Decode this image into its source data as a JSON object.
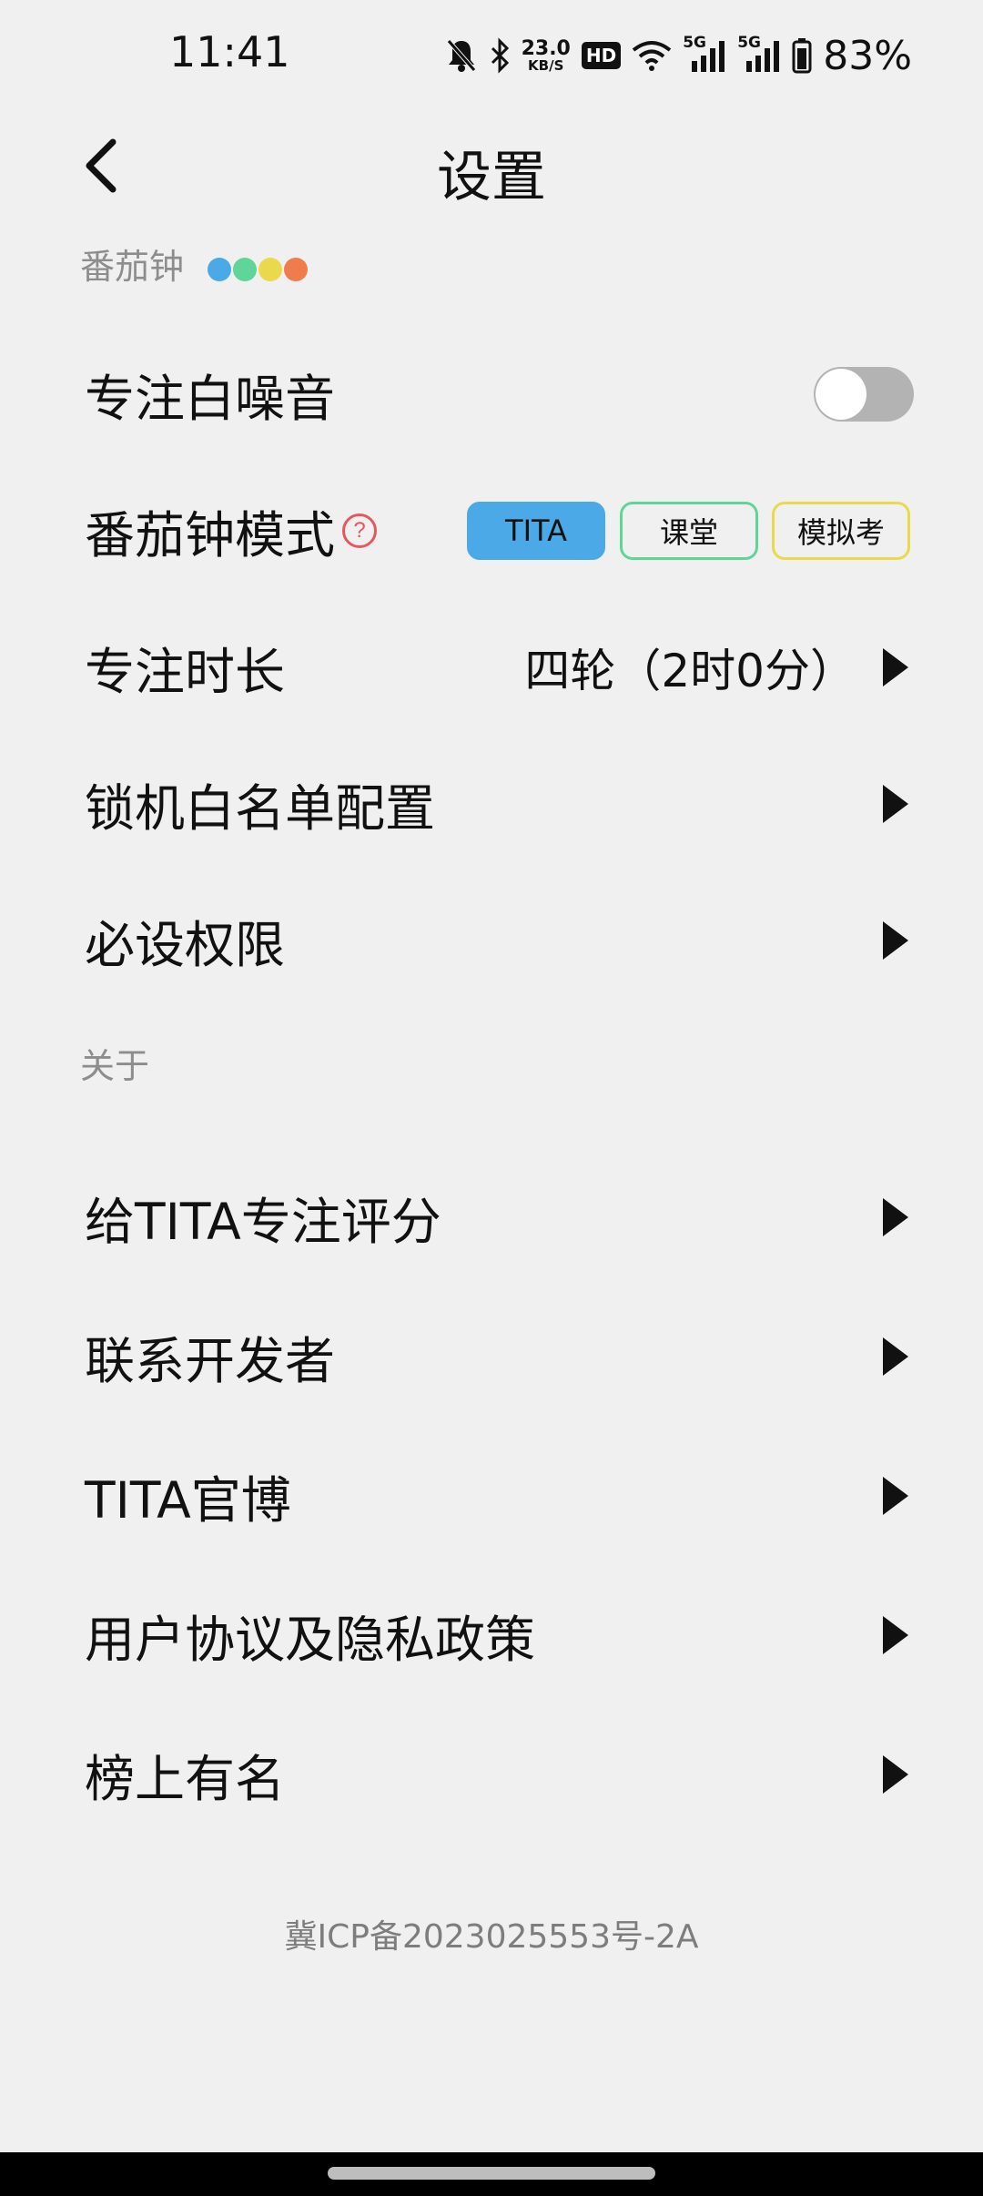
{
  "status_bar": {
    "time": "11:41",
    "net_speed_value": "23.0",
    "net_speed_unit": "KB/S",
    "hd_label": "HD",
    "network_type_1": "5G",
    "network_type_2": "5G",
    "battery_percent": "83%",
    "icons": [
      "mute-icon",
      "bluetooth-icon",
      "wifi-icon",
      "signal-icon",
      "signal-icon",
      "battery-icon"
    ]
  },
  "header": {
    "title": "设置",
    "back_icon": "chevron-left-icon"
  },
  "sections": {
    "pomodoro": {
      "title": "番茄钟",
      "dot_colors": [
        "#4aa9e6",
        "#5fd59a",
        "#ead94b",
        "#f07c4d"
      ]
    },
    "about": {
      "title": "关于"
    }
  },
  "rows": {
    "white_noise": {
      "label": "专注白噪音",
      "toggle_on": false
    },
    "mode": {
      "label": "番茄钟模式",
      "help": "?",
      "options": [
        "TITA",
        "课堂",
        "模拟考"
      ],
      "selected": "TITA"
    },
    "duration": {
      "label": "专注时长",
      "value": "四轮（2时0分）"
    },
    "whitelist": {
      "label": "锁机白名单配置"
    },
    "permissions": {
      "label": "必设权限"
    },
    "rate": {
      "label": "给TITA专注评分"
    },
    "contact": {
      "label": "联系开发者"
    },
    "weibo": {
      "label": "TITA官博"
    },
    "policy": {
      "label": "用户协议及隐私政策"
    },
    "leaderboard": {
      "label": "榜上有名"
    }
  },
  "footer": {
    "icp": "冀ICP备2023025553号-2A"
  },
  "colors": {
    "background": "#f0f0f0",
    "accent_blue": "#4aa9e6",
    "accent_green": "#5fd59a",
    "accent_yellow": "#ead94b",
    "accent_orange": "#f07c4d",
    "help_red": "#e5585b"
  }
}
